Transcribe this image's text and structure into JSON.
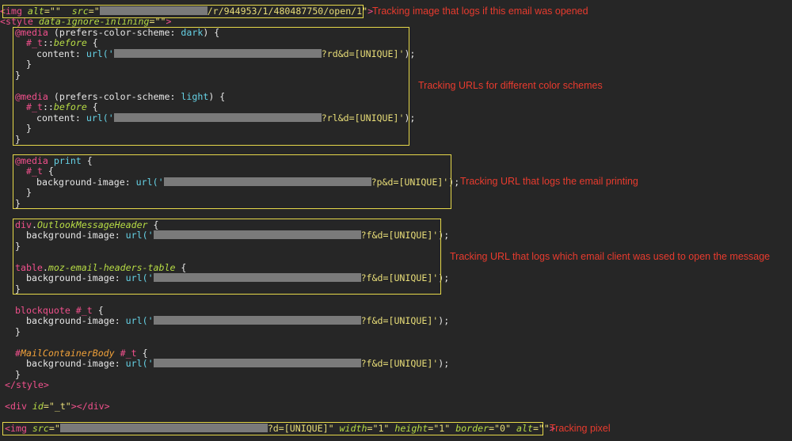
{
  "colors": {
    "background": "#262626",
    "tag_pink": "#f0508c",
    "attr_green": "#b7dc45",
    "string_yellow": "#e8dd78",
    "value_cyan": "#66d2e6",
    "selector_orange": "#f0a13a",
    "box_yellow": "#e6d84a",
    "annotation_red": "#e83b2e"
  },
  "tokens": {
    "img_open": "<img",
    "alt_attr": "alt",
    "src_attr": "src",
    "eq_empty": "=\"\"",
    "eq_quote": "=\"",
    "img1_tail": "/r/944953/1/480487750/open/1\"",
    "tag_close": ">",
    "style_open": "<style",
    "data_ignore_attr": "data-ignore-inlining",
    "style_close": "</style>",
    "at_media": "@media",
    "prefers_dark_open": " (prefers-color-scheme: ",
    "dark": "dark",
    "light": "light",
    "paren_brace": ") {",
    "print": "print",
    "brace_open": " {",
    "brace_close": "}",
    "t_before_sel": "#_t",
    "colon_colon": "::",
    "before": "before",
    "hash_t": "#_t",
    "content_prop": "content",
    "bg_prop": "background-image",
    "colon_space": ": ",
    "url_open": "url('",
    "rd_tail": "?rd&d=[UNIQUE]'",
    "rl_tail": "?rl&d=[UNIQUE]'",
    "p_tail": "?p&d=[UNIQUE]'",
    "f_tail": "?f&d=[UNIQUE]'",
    "paren_semicolon": ");",
    "div_word": "div",
    "dot": ".",
    "outlook_cls": "OutlookMessageHeader",
    "table_word": "table",
    "moz_cls": "moz-email-headers-table",
    "blockquote_word": "blockquote",
    "hash": "#",
    "mail_container": "MailContainerBody",
    "space": " ",
    "div_open": "<div",
    "id_attr": "id",
    "id_val": "=\"_t\"",
    "div_tail": "></div>",
    "pixel_tail": "?d=[UNIQUE]\"",
    "width_attr": "width",
    "height_attr": "height",
    "border_attr": "border",
    "one_val": "=\"1\"",
    "zero_val": "=\"0\""
  },
  "annotations": {
    "open_tracking": "Tracking image that logs if this email was opened",
    "color_scheme": "Tracking URLs for different color schemes",
    "printing": "Tracking URL that logs the email printing",
    "client": "Tracking URL that logs which email client was used to open the message",
    "pixel": "Tracking pixel"
  }
}
